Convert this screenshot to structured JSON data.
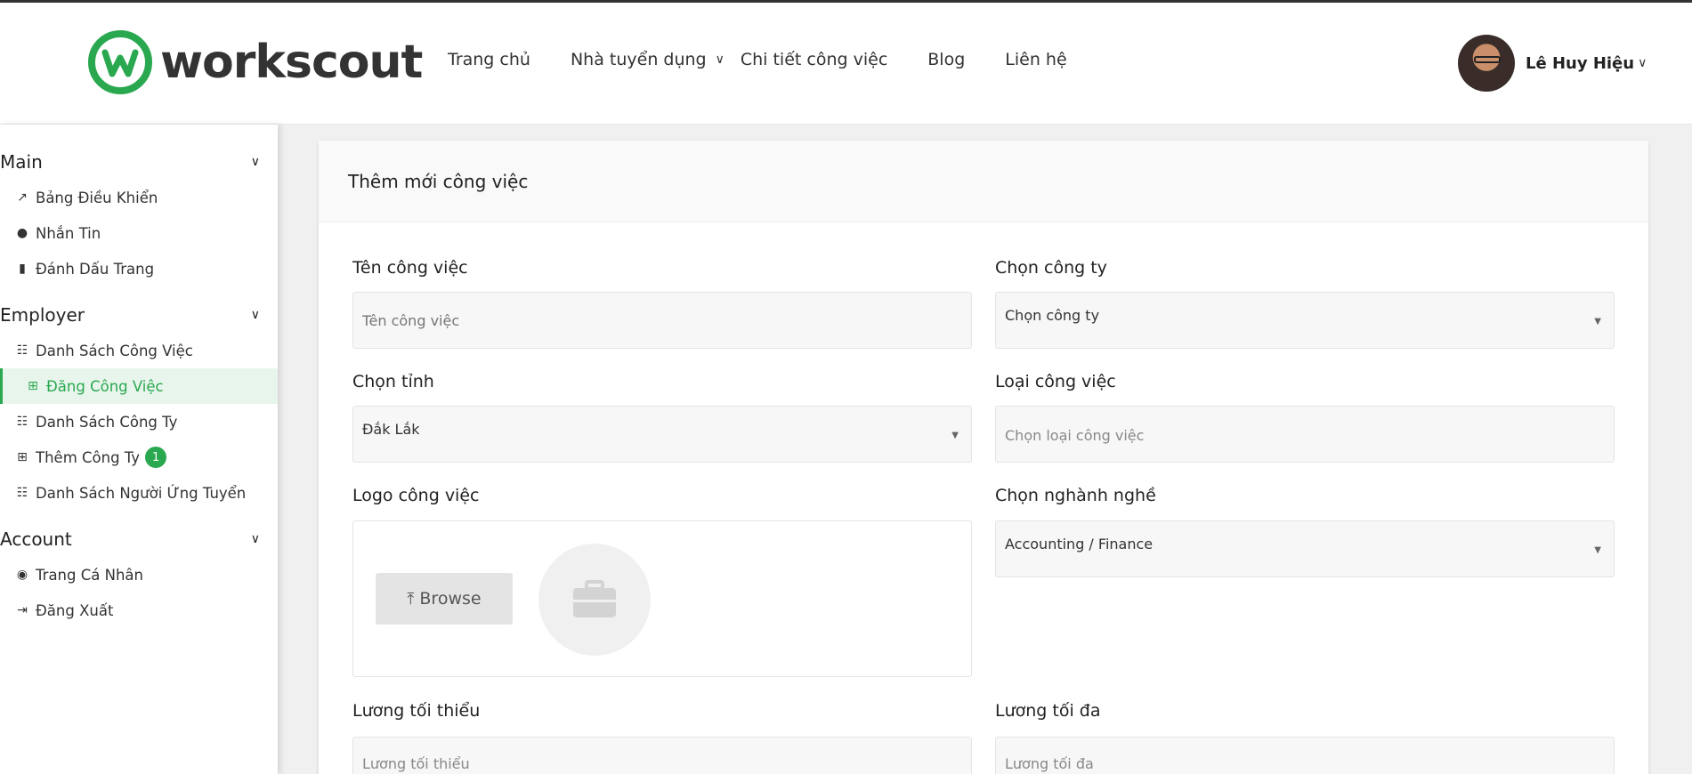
{
  "brand": {
    "name": "workscout",
    "accent": "#2aa84f"
  },
  "nav": {
    "items": [
      {
        "label": "Trang chủ"
      },
      {
        "label": "Nhà tuyển dụng",
        "has_dropdown": true
      },
      {
        "label": "Chi tiết công việc"
      },
      {
        "label": "Blog"
      },
      {
        "label": "Liên hệ"
      }
    ]
  },
  "user": {
    "name": "Lê Huy Hiệu"
  },
  "sidebar": {
    "sections": [
      {
        "title": "Main",
        "items": [
          {
            "label": "Bảng Điều Khiển",
            "icon": "chart-line-icon"
          },
          {
            "label": "Nhắn Tin",
            "icon": "comments-icon"
          },
          {
            "label": "Đánh Dấu Trang",
            "icon": "bookmark-icon"
          }
        ]
      },
      {
        "title": "Employer",
        "items": [
          {
            "label": "Danh Sách Công Việc",
            "icon": "list-icon"
          },
          {
            "label": "Đăng Công Việc",
            "icon": "plus-square-icon",
            "active": true
          },
          {
            "label": "Danh Sách Công Ty",
            "icon": "list-icon"
          },
          {
            "label": "Thêm Công Ty",
            "icon": "plus-square-icon",
            "badge": "1"
          },
          {
            "label": "Danh Sách Người Ứng Tuyển",
            "icon": "list-icon"
          }
        ]
      },
      {
        "title": "Account",
        "items": [
          {
            "label": "Trang Cá Nhân",
            "icon": "user-circle-icon"
          },
          {
            "label": "Đăng Xuất",
            "icon": "sign-out-icon"
          }
        ]
      }
    ]
  },
  "form": {
    "title": "Thêm mới công việc",
    "job_name": {
      "label": "Tên công việc",
      "placeholder": "Tên công việc"
    },
    "company": {
      "label": "Chọn công ty",
      "value": "Chọn công ty"
    },
    "province": {
      "label": "Chọn tỉnh",
      "value": "Đắk Lắk"
    },
    "job_type": {
      "label": "Loại công việc",
      "placeholder": "Chọn loại công việc"
    },
    "logo": {
      "label": "Logo công việc",
      "browse_label": "Browse"
    },
    "industry": {
      "label": "Chọn nghành nghề",
      "value": "Accounting / Finance"
    },
    "salary_min": {
      "label": "Lương tối thiểu",
      "placeholder": "Lương tối thiểu"
    },
    "salary_max": {
      "label": "Lương tối đa",
      "placeholder": "Lương tối đa"
    }
  }
}
